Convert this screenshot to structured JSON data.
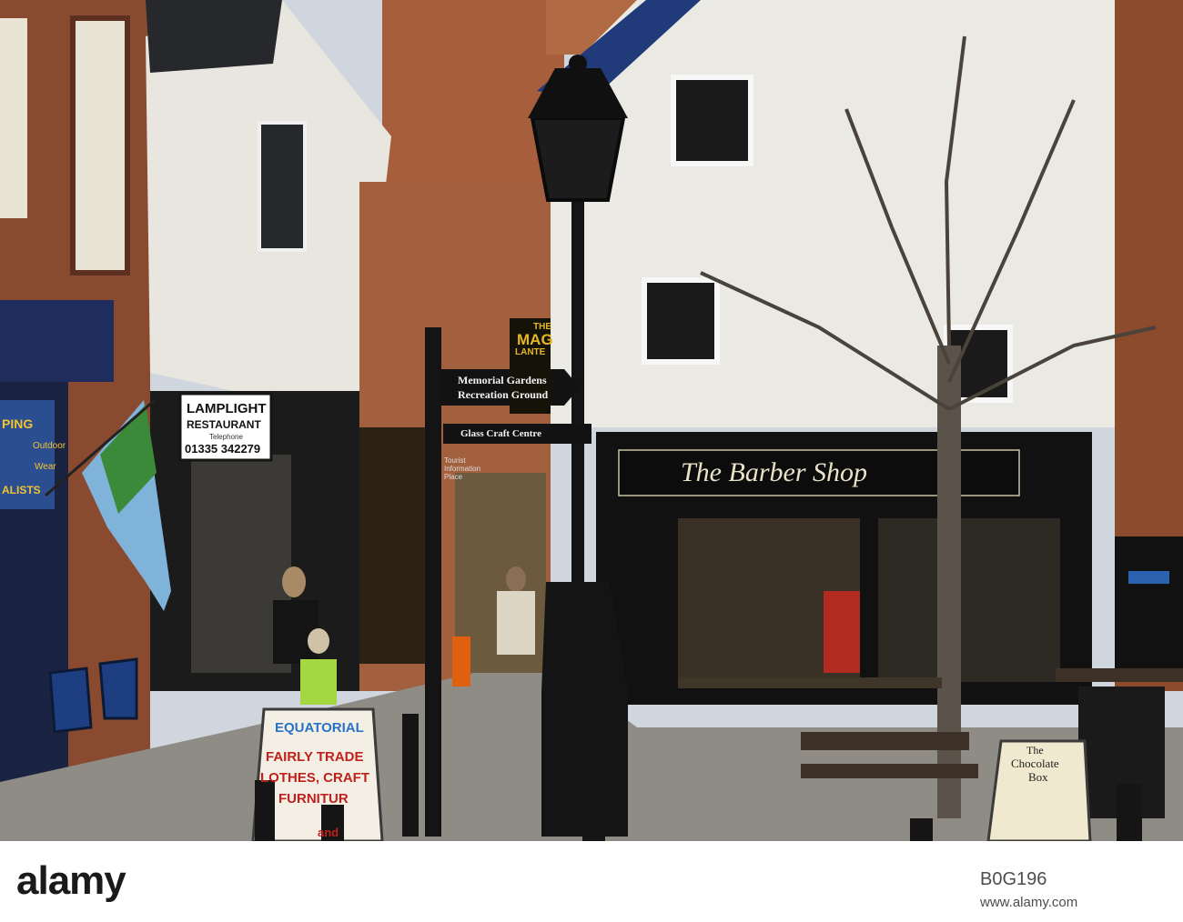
{
  "signs": {
    "lamplight_line1": "LAMPLIGHT",
    "lamplight_line2": "RESTAURANT",
    "lamplight_line3": "Telephone",
    "lamplight_phone": "01335 342279",
    "finger_1_line1": "Memorial Gardens",
    "finger_1_line2": "Recreation Ground",
    "finger_2": "Glass Craft Centre",
    "magic_lantern_1": "THE",
    "magic_lantern_2": "MAG",
    "magic_lantern_3": "LANTE",
    "barber_shop": "The Barber Shop",
    "shop_left_1": "PING",
    "shop_left_2": "Outdoor",
    "shop_left_3": "Wear",
    "shop_left_4": "ALISTS",
    "board_equatorial": "EQUATORIAL",
    "board_line1": "FAIRLY TRADE",
    "board_line2": "LOTHES, CRAFT",
    "board_line3": "FURNITUR",
    "board_line4": "and",
    "choc_line1": "The",
    "choc_line2": "Chocolate",
    "choc_line3": "Box",
    "tourist_info": "Tourist Information Place"
  },
  "footer": {
    "logo": "alamy",
    "image_id": "B0G196",
    "site": "www.alamy.com"
  },
  "colors": {
    "brick": "#8a4a30",
    "whitewash": "#e9e6df",
    "shopfront": "#121212",
    "pavement": "#8f8c86",
    "flag_blue": "#7fb3d9",
    "flag_green": "#3b8a3a"
  }
}
